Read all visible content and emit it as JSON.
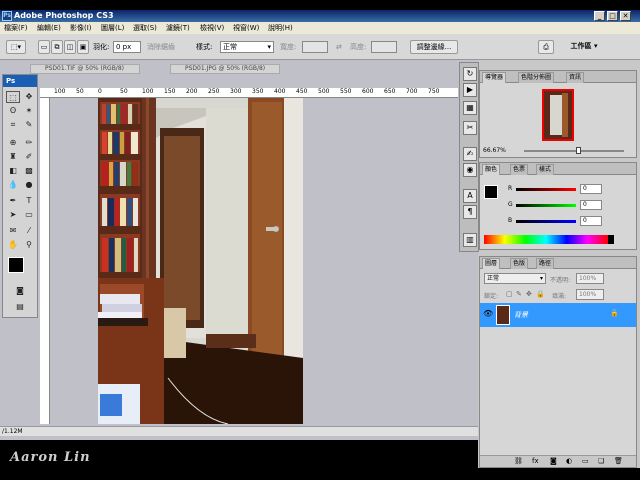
{
  "window": {
    "title": "Adobe Photoshop CS3",
    "logo": "Ps"
  },
  "menu": [
    "檔案(F)",
    "編輯(E)",
    "影像(I)",
    "圖層(L)",
    "選取(S)",
    "濾鏡(T)",
    "檢視(V)",
    "視窗(W)",
    "說明(H)"
  ],
  "options": {
    "feather_label": "羽化:",
    "feather_value": "0 px",
    "antialias_label": "消除鋸齒",
    "style_label": "樣式:",
    "style_value": "正常",
    "width_label": "寬度:",
    "height_label": "高度:",
    "refine_edge_button": "調整邊緣...",
    "workspace_button": "工作區 ▾"
  },
  "documents": {
    "tab1": "PSD01.TIF @ 50% (RGB/8)",
    "tab2": "PSD01.JPG @ 50% (RGB/8)"
  },
  "ruler_ticks": [
    "100",
    "50",
    "0",
    "50",
    "100",
    "150",
    "200",
    "250",
    "300",
    "350",
    "400",
    "450",
    "500",
    "550",
    "600",
    "650",
    "700",
    "750"
  ],
  "status": {
    "doc_size": "/1.12M"
  },
  "toolbox": {
    "badge": "Ps"
  },
  "navigator": {
    "tabs": [
      "導覽器",
      "色階分佈圖",
      "資訊"
    ],
    "zoom": "66.67%"
  },
  "color_panel": {
    "tabs": [
      "顏色",
      "色票",
      "樣式"
    ],
    "r_label": "R",
    "r_value": "0",
    "g_label": "G",
    "g_value": "0",
    "b_label": "B",
    "b_value": "0"
  },
  "layers_panel": {
    "tabs": [
      "圖層",
      "色版",
      "路徑"
    ],
    "blend_mode": "正常",
    "opacity_label": "不透明:",
    "opacity_value": "100%",
    "lock_label": "鎖定:",
    "fill_label": "填滿:",
    "fill_value": "100%",
    "layer_name": "背景"
  },
  "watermark": "Aaron Lin",
  "colors": {
    "accent_blue": "#3399ff",
    "title_bar": "#0a246a"
  }
}
